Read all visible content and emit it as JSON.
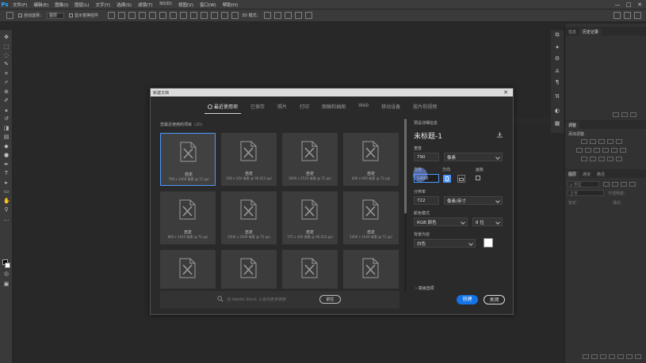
{
  "app": {
    "logo": "Ps",
    "menus": [
      "文件(F)",
      "编辑(E)",
      "图像(I)",
      "图层(L)",
      "文字(Y)",
      "选择(S)",
      "滤镜(T)",
      "3D(D)",
      "视图(V)",
      "窗口(W)",
      "帮助(H)"
    ],
    "window_controls": [
      "—",
      "□",
      "✕"
    ]
  },
  "options_bar": {
    "auto_select_label": "自动选择：",
    "auto_select_target": "图层",
    "show_transform_label": "显示变换控件",
    "mode_3d_label": "3D 模式："
  },
  "panels": {
    "top_tabs": [
      "信息",
      "历史记录"
    ],
    "adjust_tab": "调整",
    "adjust_add_label": "添加调整",
    "layers_tabs": [
      "图层",
      "通道",
      "路径"
    ],
    "kind_label": "ρ 类型",
    "normal_label": "正常",
    "opacity_label": "不透明度：",
    "lock_label": "锁定：",
    "fill_label": "填充："
  },
  "dialog": {
    "title": "新建文档",
    "close_glyph": "✕",
    "tabs": [
      "最近使用项",
      "已保存",
      "照片",
      "打印",
      "图稿和插图",
      "Web",
      "移动设备",
      "胶片和视频"
    ],
    "active_tab": 0,
    "recent_heading": "您最近使用的项目",
    "recent_count": "(20)",
    "presets": [
      {
        "name": "自定",
        "size": "790 x 1400 像素 @ 72 ppi",
        "selected": true
      },
      {
        "name": "自定",
        "size": "208 x 104 像素 @ 96.012 ppi"
      },
      {
        "name": "自定",
        "size": "3600 x 2520 像素 @ 72 ppi"
      },
      {
        "name": "自定",
        "size": "600 x 600 像素 @ 72 ppi"
      },
      {
        "name": "自定",
        "size": "800 x 1044 像素 @ 72 ppi"
      },
      {
        "name": "自定",
        "size": "2000 x 2000 像素 @ 72 ppi"
      },
      {
        "name": "自定",
        "size": "375 x 364 像素 @ 96.012 ppi"
      },
      {
        "name": "自定",
        "size": "2400 x 1044 像素 @ 72 ppi"
      },
      {
        "name": "",
        "size": ""
      },
      {
        "name": "",
        "size": ""
      },
      {
        "name": "",
        "size": ""
      },
      {
        "name": "",
        "size": ""
      }
    ],
    "stock": {
      "placeholder": "在 Adobe Stock 上查找更多模板",
      "go_label": "前往"
    },
    "details": {
      "heading": "预设详细信息",
      "doc_name": "未标题-1",
      "width_label": "宽度",
      "width_value": "790",
      "width_unit": "像素",
      "height_label": "高度",
      "height_value": "1400",
      "orientation_label": "方向",
      "artboard_label": "画板",
      "resolution_label": "分辨率",
      "resolution_value": "722",
      "resolution_unit": "像素/英寸",
      "color_mode_label": "颜色模式",
      "color_mode_value": "RGB 颜色",
      "bit_depth_value": "8 位",
      "background_label": "背景内容",
      "background_value": "白色",
      "background_color": "#ffffff",
      "advanced_label": "高级选项"
    },
    "create_label": "创建",
    "close_label": "关闭"
  },
  "colors": {
    "accent": "#1473e6",
    "selection": "#4e98ff",
    "ps_blue": "#31a8ff"
  }
}
